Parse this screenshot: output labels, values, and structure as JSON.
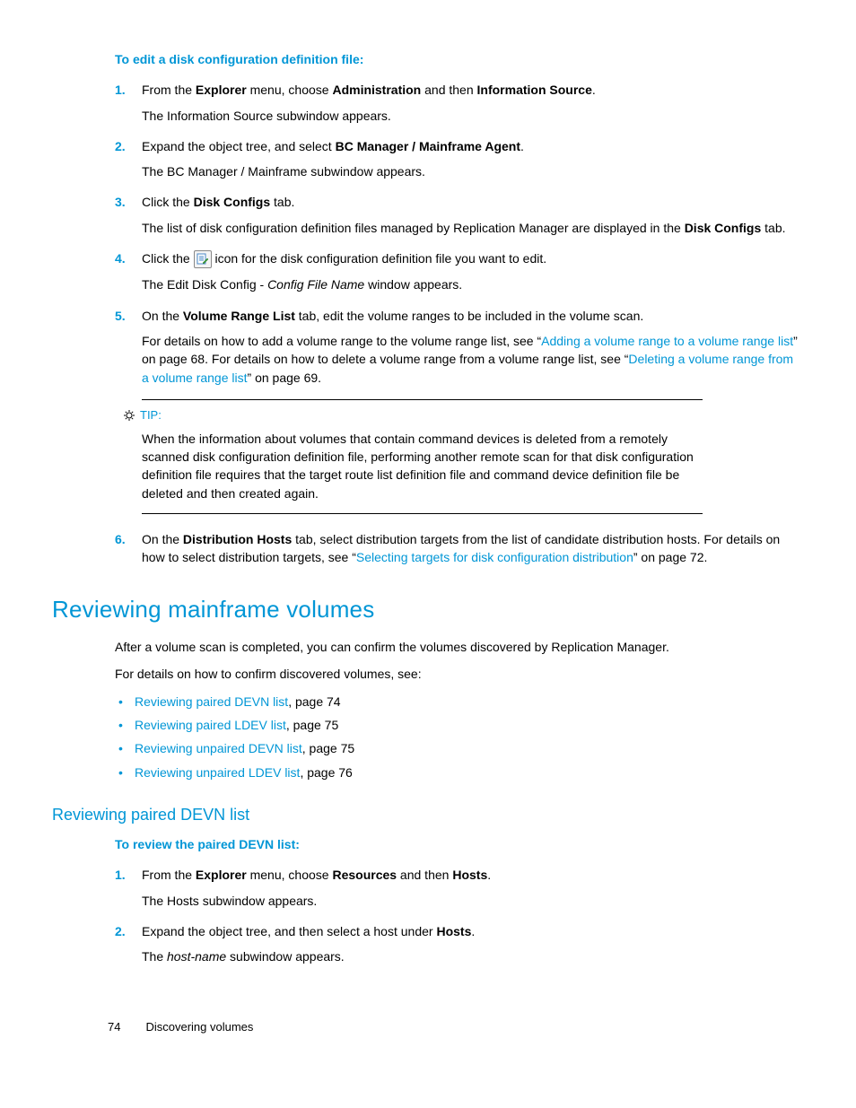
{
  "section1": {
    "heading": "To edit a disk configuration definition file:",
    "steps": [
      {
        "num": "1.",
        "line1_pre": "From the ",
        "line1_b1": "Explorer",
        "line1_mid1": " menu, choose ",
        "line1_b2": "Administration",
        "line1_mid2": " and then ",
        "line1_b3": "Information Source",
        "line1_post": ".",
        "line2": "The Information Source subwindow appears."
      },
      {
        "num": "2.",
        "line1_pre": "Expand the object tree, and select ",
        "line1_b1": "BC Manager / Mainframe Agent",
        "line1_post": ".",
        "line2": "The BC Manager / Mainframe subwindow appears."
      },
      {
        "num": "3.",
        "line1_pre": "Click the ",
        "line1_b1": "Disk Configs",
        "line1_post": " tab.",
        "line2_pre": "The list of disk configuration definition files managed by Replication Manager are displayed in the ",
        "line2_b1": "Disk Configs",
        "line2_post": " tab."
      },
      {
        "num": "4.",
        "line1_pre": "Click the ",
        "line1_post": " icon for the disk configuration definition file you want to edit.",
        "line2_pre": "The Edit Disk Config - ",
        "line2_i1": "Config File Name",
        "line2_post": " window appears."
      },
      {
        "num": "5.",
        "line1_pre": "On the ",
        "line1_b1": "Volume Range List",
        "line1_post": " tab, edit the volume ranges to be included in the volume scan.",
        "line2_pre": "For details on how to add a volume range to the volume range list, see “",
        "line2_link1": "Adding a volume range to a volume range list",
        "line2_mid": "” on page 68. For details on how to delete a volume range from a volume range list, see “",
        "line2_link2": "Deleting a volume range from a volume range list",
        "line2_post": "” on page 69."
      },
      {
        "num": "6.",
        "line1_pre": "On the ",
        "line1_b1": "Distribution Hosts",
        "line1_mid": " tab, select distribution targets from the list of candidate distribution hosts. For details on how to select distribution targets, see “",
        "line1_link1": "Selecting targets for disk configuration distribution",
        "line1_post": "” on page 72."
      }
    ],
    "tip": {
      "label": "TIP:",
      "body": "When the information about volumes that contain command devices is deleted from a remotely scanned disk configuration definition file, performing another remote scan for that disk configuration definition file requires that the target route list definition file and command device definition file be deleted and then created again."
    }
  },
  "section2": {
    "heading": "Reviewing mainframe volumes",
    "para1": "After a volume scan is completed, you can confirm the volumes discovered by Replication Manager.",
    "para2": "For details on how to confirm discovered volumes, see:",
    "bullets": [
      {
        "link": "Reviewing paired DEVN list",
        "rest": ", page 74"
      },
      {
        "link": "Reviewing paired LDEV list",
        "rest": ", page 75"
      },
      {
        "link": "Reviewing unpaired DEVN list",
        "rest": ", page 75"
      },
      {
        "link": "Reviewing unpaired LDEV list",
        "rest": ", page 76"
      }
    ]
  },
  "section3": {
    "heading": "Reviewing paired DEVN list",
    "intro": "To review the paired DEVN list:",
    "steps": [
      {
        "num": "1.",
        "line1_pre": "From the ",
        "line1_b1": "Explorer",
        "line1_mid1": " menu, choose ",
        "line1_b2": "Resources",
        "line1_mid2": " and then ",
        "line1_b3": "Hosts",
        "line1_post": ".",
        "line2": "The Hosts subwindow appears."
      },
      {
        "num": "2.",
        "line1_pre": "Expand the object tree, and then select a host under ",
        "line1_b1": "Hosts",
        "line1_post": ".",
        "line2_pre": "The ",
        "line2_i1": "host-name",
        "line2_post": " subwindow appears."
      }
    ]
  },
  "footer": {
    "page": "74",
    "title": "Discovering volumes"
  }
}
